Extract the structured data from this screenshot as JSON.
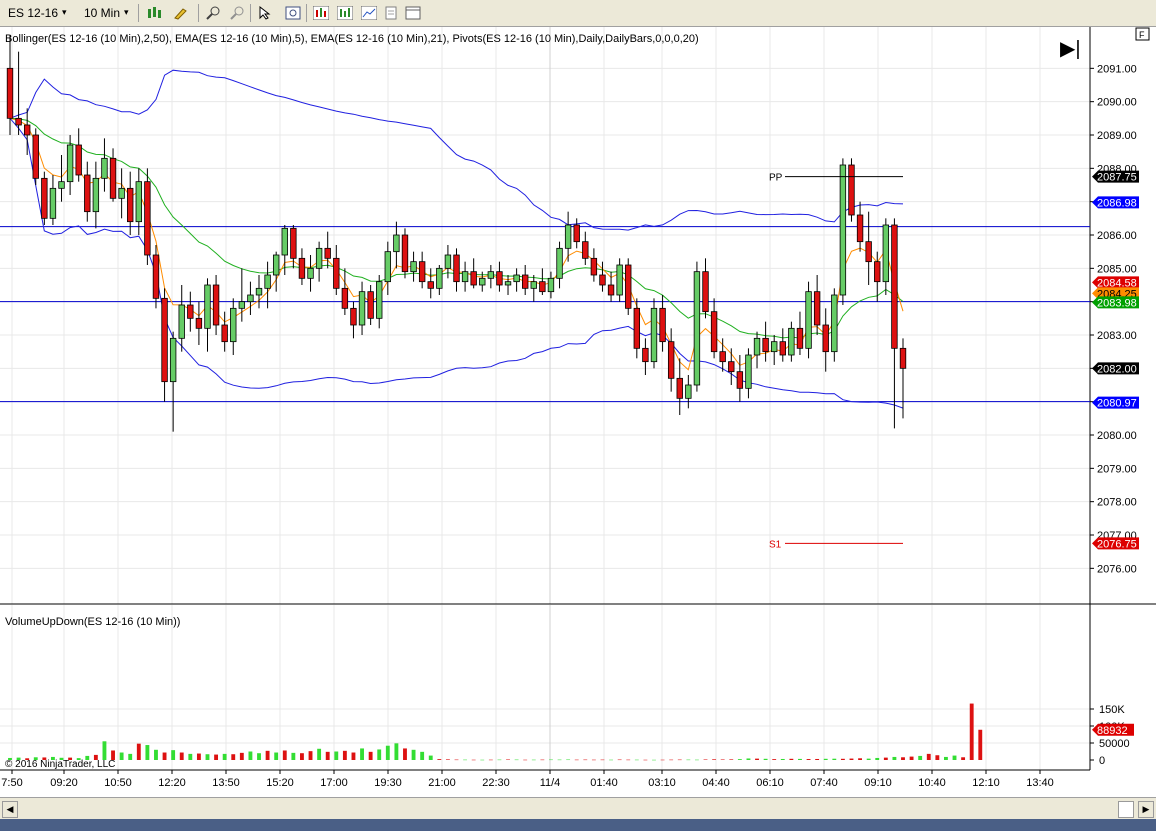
{
  "toolbar": {
    "instrument": "ES 12-16",
    "interval": "10 Min",
    "dropdown_glyph": "▾",
    "icons": [
      "bar-type-icon",
      "draw-pen-icon",
      "zoom-in-icon",
      "zoom-out-icon",
      "cursor-icon",
      "data-box-icon",
      "indicators-icon",
      "strategies-icon",
      "chart-properties-icon",
      "templates-icon",
      "tab-icon"
    ]
  },
  "chart": {
    "indicator_label": "Bollinger(ES 12-16 (10 Min),2,50), EMA(ES 12-16 (10 Min),5), EMA(ES 12-16 (10 Min),21), Pivots(ES 12-16 (10 Min),Daily,DailyBars,0,0,0,20)",
    "volume_label": "VolumeUpDown(ES 12-16 (10 Min))",
    "copyright": "© 2016 NinjaTrader, LLC",
    "f_button": "F",
    "scroll_glyph": "▶|",
    "pp_label": "PP",
    "s1_label": "S1",
    "price_axis": [
      "2091.00",
      "2090.00",
      "2089.00",
      "2088.00",
      "2087.00",
      "2086.00",
      "2085.00",
      "2084.00",
      "2083.00",
      "2082.00",
      "2081.00",
      "2080.00",
      "2079.00",
      "2078.00",
      "2077.00",
      "2076.00"
    ],
    "price_markers": [
      {
        "value": "2087.75",
        "bg": "#000000",
        "fg": "#ffffff"
      },
      {
        "value": "2086.98",
        "bg": "#0000ff",
        "fg": "#ffffff"
      },
      {
        "value": "2084.58",
        "bg": "#dd0000",
        "fg": "#ffffff"
      },
      {
        "value": "2084.25",
        "bg": "#ff8c00",
        "fg": "#000000"
      },
      {
        "value": "2083.98",
        "bg": "#00a000",
        "fg": "#ffffff"
      },
      {
        "value": "2082.00",
        "bg": "#000000",
        "fg": "#ffffff"
      },
      {
        "value": "2080.97",
        "bg": "#0000ff",
        "fg": "#ffffff"
      },
      {
        "value": "2076.75",
        "bg": "#dd0000",
        "fg": "#ffffff"
      }
    ],
    "volume_axis": [
      "150K",
      "100K",
      "50000",
      "0"
    ],
    "volume_marker": {
      "value": "88932",
      "bg": "#dd0000",
      "fg": "#ffffff"
    },
    "time_axis": [
      "7:50",
      "09:20",
      "10:50",
      "12:20",
      "13:50",
      "15:20",
      "17:00",
      "19:30",
      "21:00",
      "22:30",
      "11/4",
      "01:40",
      "03:10",
      "04:40",
      "06:10",
      "07:40",
      "09:10",
      "10:40",
      "12:10",
      "13:40"
    ]
  },
  "chart_data": {
    "type": "candlestick",
    "instrument": "ES 12-16",
    "interval": "10 Min",
    "ylim": [
      2075.5,
      2092.0
    ],
    "horizontal_lines": [
      2086.25,
      2084.0,
      2081.0
    ],
    "pivots": {
      "PP": 2087.75,
      "S1": 2076.75
    },
    "last_price": 2082.0,
    "candles": [
      [
        2091.0,
        2092.0,
        2089.0,
        2089.5
      ],
      [
        2089.5,
        2091.5,
        2089.0,
        2089.3
      ],
      [
        2089.3,
        2089.8,
        2088.4,
        2089.0
      ],
      [
        2089.0,
        2089.2,
        2087.5,
        2087.7
      ],
      [
        2087.7,
        2087.9,
        2086.3,
        2086.5
      ],
      [
        2086.5,
        2087.8,
        2086.3,
        2087.4
      ],
      [
        2087.4,
        2088.4,
        2087.0,
        2087.6
      ],
      [
        2087.6,
        2089.0,
        2087.2,
        2088.7
      ],
      [
        2088.7,
        2089.2,
        2087.6,
        2087.8
      ],
      [
        2087.8,
        2088.2,
        2086.4,
        2086.7
      ],
      [
        2086.7,
        2088.2,
        2086.2,
        2087.7
      ],
      [
        2087.7,
        2088.9,
        2087.3,
        2088.3
      ],
      [
        2088.3,
        2088.6,
        2087.0,
        2087.1
      ],
      [
        2087.1,
        2088.0,
        2086.5,
        2087.4
      ],
      [
        2087.4,
        2087.9,
        2086.0,
        2086.4
      ],
      [
        2086.4,
        2088.0,
        2086.0,
        2087.6
      ],
      [
        2087.6,
        2088.0,
        2085.1,
        2085.4
      ],
      [
        2085.4,
        2085.7,
        2083.8,
        2084.1
      ],
      [
        2084.1,
        2084.4,
        2081.0,
        2081.6
      ],
      [
        2081.6,
        2083.1,
        2080.1,
        2082.9
      ],
      [
        2082.9,
        2084.5,
        2082.5,
        2083.9
      ],
      [
        2083.9,
        2084.3,
        2083.1,
        2083.5
      ],
      [
        2083.5,
        2084.0,
        2082.7,
        2083.2
      ],
      [
        2083.2,
        2084.7,
        2082.5,
        2084.5
      ],
      [
        2084.5,
        2084.8,
        2083.0,
        2083.3
      ],
      [
        2083.3,
        2083.7,
        2082.5,
        2082.8
      ],
      [
        2082.8,
        2084.1,
        2082.4,
        2083.8
      ],
      [
        2083.8,
        2085.0,
        2083.4,
        2084.0
      ],
      [
        2084.0,
        2084.6,
        2083.6,
        2084.2
      ],
      [
        2084.2,
        2084.8,
        2083.8,
        2084.4
      ],
      [
        2084.4,
        2085.2,
        2083.8,
        2084.8
      ],
      [
        2084.8,
        2085.5,
        2084.3,
        2085.4
      ],
      [
        2085.4,
        2086.3,
        2084.8,
        2086.2
      ],
      [
        2086.2,
        2086.3,
        2085.0,
        2085.3
      ],
      [
        2085.3,
        2085.6,
        2084.5,
        2084.7
      ],
      [
        2084.7,
        2085.4,
        2084.3,
        2085.0
      ],
      [
        2085.0,
        2085.8,
        2084.6,
        2085.6
      ],
      [
        2085.6,
        2086.1,
        2085.0,
        2085.3
      ],
      [
        2085.3,
        2085.7,
        2084.2,
        2084.4
      ],
      [
        2084.4,
        2085.0,
        2083.6,
        2083.8
      ],
      [
        2083.8,
        2084.0,
        2082.9,
        2083.3
      ],
      [
        2083.3,
        2084.6,
        2083.0,
        2084.3
      ],
      [
        2084.3,
        2084.5,
        2083.3,
        2083.5
      ],
      [
        2083.5,
        2084.8,
        2083.2,
        2084.6
      ],
      [
        2084.6,
        2085.8,
        2084.2,
        2085.5
      ],
      [
        2085.5,
        2086.4,
        2085.0,
        2086.0
      ],
      [
        2086.0,
        2086.2,
        2084.7,
        2084.9
      ],
      [
        2084.9,
        2085.5,
        2084.6,
        2085.2
      ],
      [
        2085.2,
        2085.5,
        2084.4,
        2084.6
      ],
      [
        2084.6,
        2085.0,
        2084.1,
        2084.4
      ],
      [
        2084.4,
        2085.1,
        2084.2,
        2085.0
      ],
      [
        2085.0,
        2085.7,
        2084.7,
        2085.4
      ],
      [
        2085.4,
        2085.6,
        2084.3,
        2084.6
      ],
      [
        2084.6,
        2085.2,
        2084.3,
        2084.9
      ],
      [
        2084.9,
        2085.3,
        2084.4,
        2084.5
      ],
      [
        2084.5,
        2084.9,
        2084.3,
        2084.7
      ],
      [
        2084.7,
        2085.1,
        2084.4,
        2084.9
      ],
      [
        2084.9,
        2085.2,
        2084.3,
        2084.5
      ],
      [
        2084.5,
        2084.8,
        2084.2,
        2084.6
      ],
      [
        2084.6,
        2085.0,
        2084.3,
        2084.8
      ],
      [
        2084.8,
        2085.1,
        2084.2,
        2084.4
      ],
      [
        2084.4,
        2084.8,
        2084.0,
        2084.6
      ],
      [
        2084.6,
        2085.0,
        2084.2,
        2084.3
      ],
      [
        2084.3,
        2084.9,
        2084.1,
        2084.7
      ],
      [
        2084.7,
        2085.8,
        2084.4,
        2085.6
      ],
      [
        2085.6,
        2086.7,
        2085.2,
        2086.3
      ],
      [
        2086.3,
        2086.5,
        2085.6,
        2085.8
      ],
      [
        2085.8,
        2086.1,
        2085.1,
        2085.3
      ],
      [
        2085.3,
        2085.6,
        2084.6,
        2084.8
      ],
      [
        2084.8,
        2085.2,
        2084.3,
        2084.5
      ],
      [
        2084.5,
        2084.9,
        2084.0,
        2084.2
      ],
      [
        2084.2,
        2085.3,
        2084.0,
        2085.1
      ],
      [
        2085.1,
        2085.3,
        2083.6,
        2083.8
      ],
      [
        2083.8,
        2084.1,
        2082.3,
        2082.6
      ],
      [
        2082.6,
        2082.9,
        2081.8,
        2082.2
      ],
      [
        2082.2,
        2084.1,
        2082.0,
        2083.8
      ],
      [
        2083.8,
        2084.2,
        2082.5,
        2082.8
      ],
      [
        2082.8,
        2083.2,
        2081.3,
        2081.7
      ],
      [
        2081.7,
        2082.3,
        2080.6,
        2081.1
      ],
      [
        2081.1,
        2081.8,
        2080.8,
        2081.5
      ],
      [
        2081.5,
        2085.2,
        2081.3,
        2084.9
      ],
      [
        2084.9,
        2085.3,
        2083.5,
        2083.7
      ],
      [
        2083.7,
        2084.1,
        2082.3,
        2082.5
      ],
      [
        2082.5,
        2082.9,
        2081.9,
        2082.2
      ],
      [
        2082.2,
        2082.6,
        2081.5,
        2081.9
      ],
      [
        2081.9,
        2082.4,
        2081.0,
        2081.4
      ],
      [
        2081.4,
        2082.6,
        2081.1,
        2082.4
      ],
      [
        2082.4,
        2083.1,
        2082.0,
        2082.9
      ],
      [
        2082.9,
        2083.4,
        2082.2,
        2082.5
      ],
      [
        2082.5,
        2083.0,
        2082.1,
        2082.8
      ],
      [
        2082.8,
        2083.2,
        2082.2,
        2082.4
      ],
      [
        2082.4,
        2083.4,
        2082.2,
        2083.2
      ],
      [
        2083.2,
        2083.7,
        2082.4,
        2082.6
      ],
      [
        2082.6,
        2084.6,
        2082.3,
        2084.3
      ],
      [
        2084.3,
        2084.8,
        2083.0,
        2083.3
      ],
      [
        2083.3,
        2083.8,
        2081.9,
        2082.5
      ],
      [
        2082.5,
        2084.4,
        2082.2,
        2084.2
      ],
      [
        2084.2,
        2088.3,
        2083.9,
        2088.1
      ],
      [
        2088.1,
        2088.3,
        2086.4,
        2086.6
      ],
      [
        2086.6,
        2087.0,
        2085.5,
        2085.8
      ],
      [
        2085.8,
        2086.7,
        2084.5,
        2085.2
      ],
      [
        2085.2,
        2085.5,
        2084.0,
        2084.6
      ],
      [
        2084.6,
        2086.5,
        2084.2,
        2086.3
      ],
      [
        2086.3,
        2086.5,
        2080.2,
        2082.6
      ],
      [
        2082.6,
        2082.9,
        2080.5,
        2082.0
      ]
    ],
    "volume": [
      6000,
      7000,
      5000,
      8000,
      7500,
      9000,
      6500,
      7000,
      5500,
      12000,
      15000,
      55000,
      28000,
      22000,
      18000,
      48000,
      44000,
      30000,
      22000,
      29000,
      22000,
      18000,
      19000,
      17000,
      16000,
      18000,
      17000,
      21000,
      25000,
      20000,
      27000,
      22000,
      28000,
      21000,
      20000,
      26000,
      33000,
      24000,
      25000,
      27000,
      22000,
      34000,
      24000,
      31000,
      42000,
      49000,
      34000,
      30000,
      24000,
      13000,
      2500,
      1800,
      1200,
      1000,
      800,
      700,
      900,
      1100,
      1500,
      1200,
      800,
      900,
      1100,
      1300,
      1100,
      1400,
      1000,
      1200,
      900,
      1100,
      800,
      1300,
      1000,
      900,
      700,
      600,
      800,
      1000,
      1200,
      1100,
      900,
      1500,
      2000,
      1500,
      1800,
      2500,
      4500,
      4000,
      3500,
      2500,
      3000,
      3500,
      3200,
      2800,
      3000,
      3500,
      3800,
      3500,
      4200,
      5000,
      4000,
      6000,
      7000,
      9000,
      8000,
      10000,
      12000,
      18000,
      14000,
      9000,
      13000,
      8000,
      166000,
      88932
    ],
    "volume_up": [
      1,
      1,
      0,
      1,
      0,
      1,
      1,
      0,
      1,
      1,
      0,
      1,
      0,
      1,
      1,
      0,
      1,
      1,
      0,
      1,
      0,
      1,
      0,
      1,
      0,
      1,
      0,
      0,
      1,
      1,
      0,
      1,
      0,
      1,
      0,
      0,
      1,
      0,
      1,
      0,
      0,
      1,
      0,
      1,
      1,
      1,
      0,
      1,
      1,
      1,
      0,
      0,
      0,
      1,
      0,
      1,
      0,
      1,
      0,
      1,
      0,
      1,
      0,
      1,
      1,
      1,
      0,
      0,
      0,
      0,
      1,
      0,
      0,
      1,
      0,
      1,
      0,
      0,
      0,
      1,
      1,
      0,
      0,
      0,
      0,
      1,
      1,
      0,
      1,
      0,
      1,
      0,
      1,
      0,
      0,
      1,
      1,
      0,
      0,
      0,
      1,
      1,
      0,
      1,
      0,
      0,
      1,
      0,
      0,
      1,
      1,
      0
    ]
  }
}
